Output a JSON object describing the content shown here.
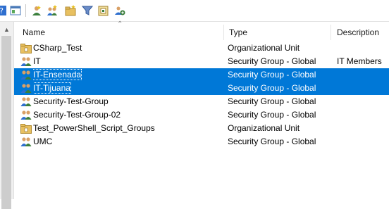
{
  "toolbar": {
    "icons": [
      "help-icon",
      "console-tree-icon",
      "create-user-icon",
      "create-group-icon",
      "create-ou-icon",
      "filter-icon",
      "group-policy-icon",
      "add-to-group-icon"
    ]
  },
  "columns": {
    "name": "Name",
    "type": "Type",
    "description": "Description"
  },
  "rows": [
    {
      "name": "CSharp_Test",
      "type": "Organizational Unit",
      "description": "",
      "icon": "ou-folder-icon",
      "selected": false
    },
    {
      "name": "IT",
      "type": "Security Group - Global",
      "description": "IT Members",
      "icon": "group-icon",
      "selected": false
    },
    {
      "name": "IT-Ensenada",
      "type": "Security Group - Global",
      "description": "",
      "icon": "group-icon",
      "selected": true
    },
    {
      "name": "IT-Tijuana",
      "type": "Security Group - Global",
      "description": "",
      "icon": "group-icon",
      "selected": true
    },
    {
      "name": "Security-Test-Group",
      "type": "Security Group - Global",
      "description": "",
      "icon": "group-icon",
      "selected": false
    },
    {
      "name": "Security-Test-Group-02",
      "type": "Security Group - Global",
      "description": "",
      "icon": "group-icon",
      "selected": false
    },
    {
      "name": "Test_PowerShell_Script_Groups",
      "type": "Organizational Unit",
      "description": "",
      "icon": "ou-folder-icon",
      "selected": false
    },
    {
      "name": "UMC",
      "type": "Security Group - Global",
      "description": "",
      "icon": "group-icon",
      "selected": false
    }
  ],
  "colors": {
    "selection": "#0078d7"
  }
}
